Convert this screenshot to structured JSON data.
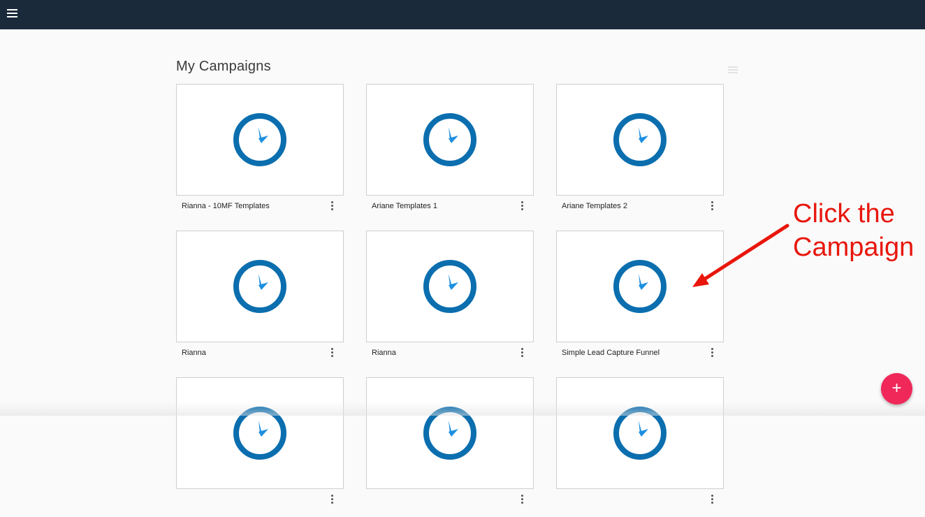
{
  "header": {
    "menu_icon": "hamburger-menu-icon",
    "background": "#1b2a3a"
  },
  "main": {
    "title": "My Campaigns",
    "view_toggle_icon": "list-view-icon"
  },
  "campaigns": [
    {
      "name": "Rianna - 10MF Templates",
      "thumbnail_icon": "clock-icon"
    },
    {
      "name": "Ariane Templates 1",
      "thumbnail_icon": "clock-icon"
    },
    {
      "name": "Ariane Templates 2",
      "thumbnail_icon": "clock-icon"
    },
    {
      "name": "Rianna",
      "thumbnail_icon": "clock-icon"
    },
    {
      "name": "Rianna",
      "thumbnail_icon": "clock-icon"
    },
    {
      "name": "Simple Lead Capture Funnel",
      "thumbnail_icon": "clock-icon"
    },
    {
      "name": "",
      "thumbnail_icon": "clock-icon"
    },
    {
      "name": "",
      "thumbnail_icon": "clock-icon"
    },
    {
      "name": "",
      "thumbnail_icon": "clock-icon"
    }
  ],
  "annotation": {
    "line1": "Click the",
    "line2": "Campaign",
    "color": "#e8160c"
  },
  "fab": {
    "label": "+",
    "color": "#f0285a"
  },
  "colors": {
    "clock_ring": "#0b6eae",
    "clock_hand": "#1c8fe0"
  }
}
